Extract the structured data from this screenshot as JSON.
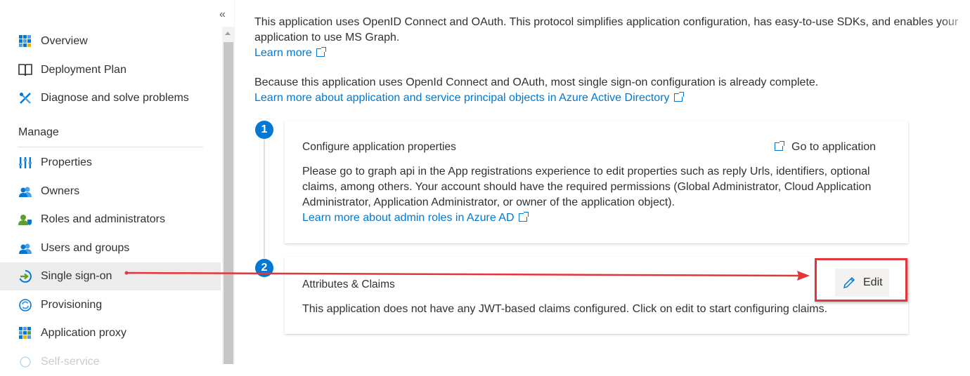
{
  "sidebar": {
    "collapse_glyph": "«",
    "items_top": [
      {
        "label": "Overview",
        "icon": "overview-grid-icon"
      },
      {
        "label": "Deployment Plan",
        "icon": "book-icon"
      },
      {
        "label": "Diagnose and solve problems",
        "icon": "wrench-cross-icon"
      }
    ],
    "manage_header": "Manage",
    "items_manage": [
      {
        "label": "Properties",
        "icon": "properties-bars-icon"
      },
      {
        "label": "Owners",
        "icon": "people-icon"
      },
      {
        "label": "Roles and administrators",
        "icon": "person-shield-icon"
      },
      {
        "label": "Users and groups",
        "icon": "people-icon"
      },
      {
        "label": "Single sign-on",
        "icon": "sso-arrow-icon",
        "selected": true
      },
      {
        "label": "Provisioning",
        "icon": "sync-icon"
      },
      {
        "label": "Application proxy",
        "icon": "grid-proxy-icon"
      },
      {
        "label": "Self-service",
        "icon": "self-service-icon"
      }
    ]
  },
  "main": {
    "intro_line1": "This application uses OpenID Connect and OAuth. This protocol simplifies application configuration, has easy-to-use SDKs, and enables your",
    "intro_line2": "application to use MS Graph.",
    "learn_more": "Learn more",
    "sso_line": "Because this application uses OpenId Connect and OAuth, most single sign-on configuration is already complete.",
    "sso_link": "Learn more about application and service principal objects in Azure Active Directory",
    "step1": {
      "number": "1",
      "title": "Configure application properties",
      "action": "Go to application",
      "body_line1": "Please go to graph api in the App registrations experience to edit properties such as reply Urls, identifiers, optional",
      "body_line2": "claims, among others. Your account should have the required permissions (Global Administrator, Cloud Application",
      "body_line3": "Administrator, Application Administrator, or owner of the application object).",
      "link": "Learn more about admin roles in Azure AD"
    },
    "step2": {
      "number": "2",
      "title": "Attributes & Claims",
      "edit_label": "Edit",
      "body": "This application does not have any JWT-based claims configured. Click on edit to start configuring claims."
    }
  },
  "colors": {
    "accent": "#0078d4",
    "annotation_red": "#e1363a",
    "selected_bg": "#ececec"
  }
}
